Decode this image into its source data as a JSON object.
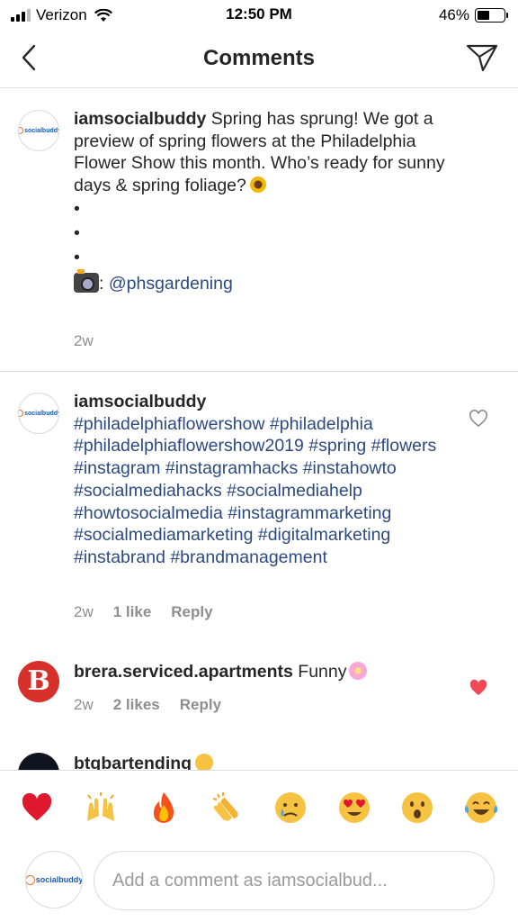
{
  "status_bar": {
    "carrier": "Verizon",
    "time": "12:50 PM",
    "battery": "46%",
    "battery_level": 0.46
  },
  "nav": {
    "title": "Comments",
    "back_icon": "chevron-left-icon",
    "send_icon": "paper-plane-icon"
  },
  "caption": {
    "username": "iamsocialbuddy",
    "text": "Spring has sprung! We got a preview of spring flowers at the Philadelphia Flower Show this month. Who’s ready for sunny days & spring foliage?",
    "bullets": [
      "•",
      "•",
      "•"
    ],
    "credit_prefix": ":",
    "credit_handle": "@phsgardening",
    "time": "2w",
    "avatar_text": "socialbuddy"
  },
  "comments": [
    {
      "username": "iamsocialbuddy",
      "hashtags": "#philadelphiaflowershow  #philadelphia #philadelphiaflowershow2019 #spring #flowers #instagram #instagramhacks #instahowto #socialmediahacks #socialmediahelp #howtosocialmedia #instagrammarketing #socialmediamarketing #digitalmarketing #instabrand #brandmanagement",
      "time": "2w",
      "likes": "1 like",
      "reply": "Reply",
      "liked": false,
      "avatar_text": "socialbuddy"
    },
    {
      "username": "brera.serviced.apartments",
      "text": "Funny",
      "time": "2w",
      "likes": "2 likes",
      "reply": "Reply",
      "liked": true,
      "avatar_letter": "B"
    },
    {
      "username": "btgbartending"
    }
  ],
  "emoji_bar": [
    "heart",
    "raised-hands",
    "fire",
    "clapping-hands",
    "crying-face",
    "heart-eyes-face",
    "surprised-face",
    "tears-of-joy-face"
  ],
  "input": {
    "placeholder": "Add a comment as iamsocialbud...",
    "avatar_text": "socialbuddy"
  },
  "colors": {
    "link": "#2c4a80",
    "meta": "#8e8e8e",
    "like_red": "#ed4956",
    "divider": "#dbdbdb"
  }
}
